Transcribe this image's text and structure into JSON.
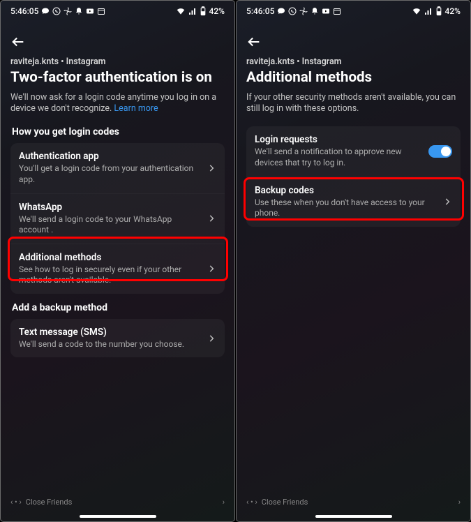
{
  "status": {
    "time": "5:46:05",
    "battery": "42%"
  },
  "left": {
    "breadcrumb": "raviteja.knts • Instagram",
    "title": "Two-factor authentication is on",
    "description": "We'll now ask for a login code anytime you log in on a device we don't recognize. ",
    "learn": "Learn more",
    "sections": {
      "howto": "How you get login codes",
      "backup": "Add a backup method"
    },
    "rows": {
      "auth": {
        "t": "Authentication app",
        "s": "You'll get a login code from your authentication app."
      },
      "wa": {
        "t": "WhatsApp",
        "s": "We'll send a login code to your WhatsApp account ."
      },
      "addl": {
        "t": "Additional methods",
        "s": "See how to log in securely even if your other methods aren't available."
      },
      "sms": {
        "t": "Text message (SMS)",
        "s": "We'll send a code to the number you choose."
      }
    },
    "nav": "Close Friends"
  },
  "right": {
    "breadcrumb": "raviteja.knts • Instagram",
    "title": "Additional methods",
    "description": "If your other security methods aren't available, you can still log in with these options.",
    "rows": {
      "req": {
        "t": "Login requests",
        "s": "We'll send a notification to approve new devices that try to log in."
      },
      "bak": {
        "t": "Backup codes",
        "s": "Use these when you don't have access to your phone."
      }
    },
    "nav": "Close Friends"
  }
}
